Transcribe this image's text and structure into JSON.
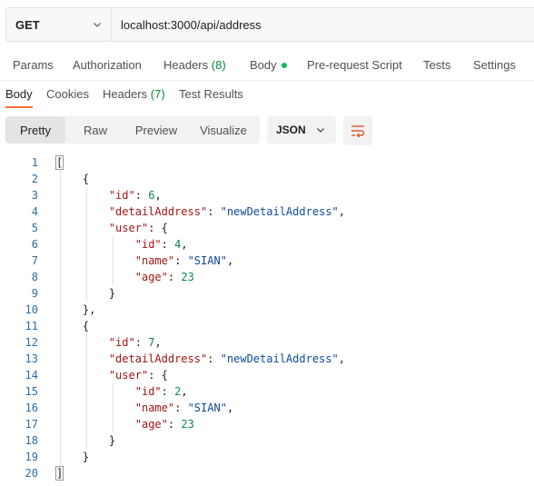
{
  "request": {
    "method": "GET",
    "url": "localhost:3000/api/address"
  },
  "request_tabs": [
    {
      "label": "Params"
    },
    {
      "label": "Authorization"
    },
    {
      "label": "Headers",
      "count": "(8)"
    },
    {
      "label": "Body"
    },
    {
      "label": "Pre-request Script"
    },
    {
      "label": "Tests"
    },
    {
      "label": "Settings"
    }
  ],
  "response_tabs": [
    {
      "label": "Body"
    },
    {
      "label": "Cookies"
    },
    {
      "label": "Headers",
      "count": "(7)"
    },
    {
      "label": "Test Results"
    }
  ],
  "format_options": [
    "Pretty",
    "Raw",
    "Preview",
    "Visualize"
  ],
  "selected_format": "Pretty",
  "language": "JSON",
  "code_lines": [
    "[",
    "{",
    "\"id\": 6,",
    "\"detailAddress\": \"newDetailAddress\",",
    "\"user\": {",
    "\"id\": 4,",
    "\"name\": \"SIAN\",",
    "\"age\": 23",
    "}",
    "},",
    "{",
    "\"id\": 7,",
    "\"detailAddress\": \"newDetailAddress\",",
    "\"user\": {",
    "\"id\": 2,",
    "\"name\": \"SIAN\",",
    "\"age\": 23",
    "}",
    "}",
    "]"
  ],
  "line_numbers": [
    "1",
    "2",
    "3",
    "4",
    "5",
    "6",
    "7",
    "8",
    "9",
    "10",
    "11",
    "12",
    "13",
    "14",
    "15",
    "16",
    "17",
    "18",
    "19",
    "20"
  ],
  "colors": {
    "accent": "#ff6c37",
    "count_green": "#0a8a3a",
    "dot_green": "#0cbb52",
    "json_key": "#a31515",
    "json_string": "#0e4b9a",
    "json_number": "#098658"
  }
}
